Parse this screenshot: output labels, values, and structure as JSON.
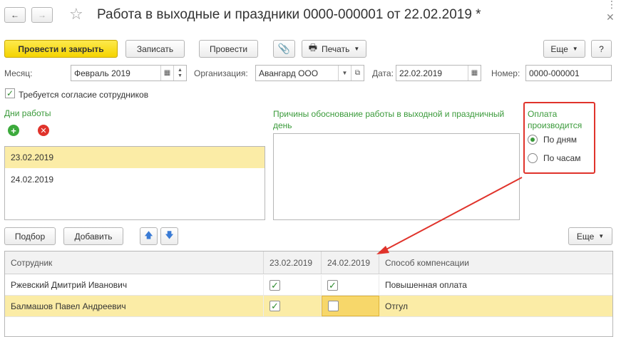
{
  "window": {
    "title": "Работа в выходные и праздники 0000-000001 от 22.02.2019 *",
    "back_icon": "arrow-left",
    "forward_icon": "arrow-right",
    "favorite_icon": "star-outline",
    "more_icon": "vertical-dots",
    "close_icon": "close-x"
  },
  "toolbar": {
    "post_close": "Провести и закрыть",
    "save": "Записать",
    "post": "Провести",
    "print": "Печать",
    "more": "Еще",
    "help": "?"
  },
  "header": {
    "month_label": "Месяц:",
    "month_value": "Февраль 2019",
    "org_label": "Организация:",
    "org_value": "Авангард ООО",
    "date_label": "Дата:",
    "date_value": "22.02.2019",
    "number_label": "Номер:",
    "number_value": "0000-000001"
  },
  "consent": {
    "label": "Требуется согласие сотрудников",
    "checked": true
  },
  "work_days": {
    "title": "Дни работы",
    "items": [
      "23.02.2019",
      "24.02.2019"
    ],
    "selected_index": 0
  },
  "reasons": {
    "title": "Причины обоснование работы в выходной и праздничный день",
    "value": ""
  },
  "payment": {
    "title": "Оплата производится",
    "options": [
      "По дням",
      "По часам"
    ],
    "selected": "По дням"
  },
  "grid_toolbar": {
    "select": "Подбор",
    "add": "Добавить",
    "more": "Еще"
  },
  "table": {
    "columns": [
      "Сотрудник",
      "23.02.2019",
      "24.02.2019",
      "Способ компенсации"
    ],
    "rows": [
      {
        "employee": "Ржевский Дмитрий Иванович",
        "day1": true,
        "day2": true,
        "compensation": "Повышенная оплата"
      },
      {
        "employee": "Балмашов Павел Андреевич",
        "day1": true,
        "day2": false,
        "compensation": "Отгул"
      }
    ]
  },
  "colors": {
    "accent_green": "#3a9a3a",
    "primary_button": "#f5d400",
    "selection": "#fbeca6",
    "highlight_red": "#e0332b"
  }
}
